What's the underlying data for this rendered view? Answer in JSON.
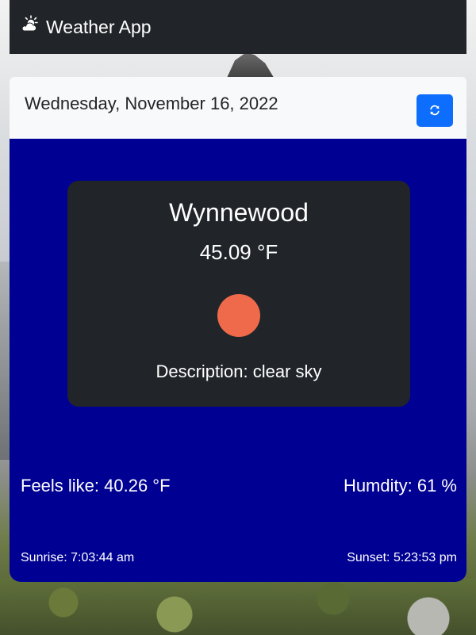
{
  "navbar": {
    "brand": "Weather App",
    "icon": "sun-cloud-icon"
  },
  "date_bar": {
    "date": "Wednesday, November 16, 2022",
    "refresh_icon": "refresh-icon",
    "refresh_color": "#0d6efd"
  },
  "weather": {
    "city": "Wynnewood",
    "temperature": "45.09 °F",
    "icon": "sun-icon",
    "description": "Description: clear sky",
    "feels_like": "Feels like: 40.26 °F",
    "humidity": "Humdity: 61 %",
    "sunrise": "Sunrise: 7:03:44 am",
    "sunset": "Sunset: 5:23:53 pm"
  },
  "colors": {
    "navbar_bg": "#212529",
    "card_bg": "#000093",
    "weather_box_bg": "#212529",
    "sun": "#ef6a4a"
  }
}
